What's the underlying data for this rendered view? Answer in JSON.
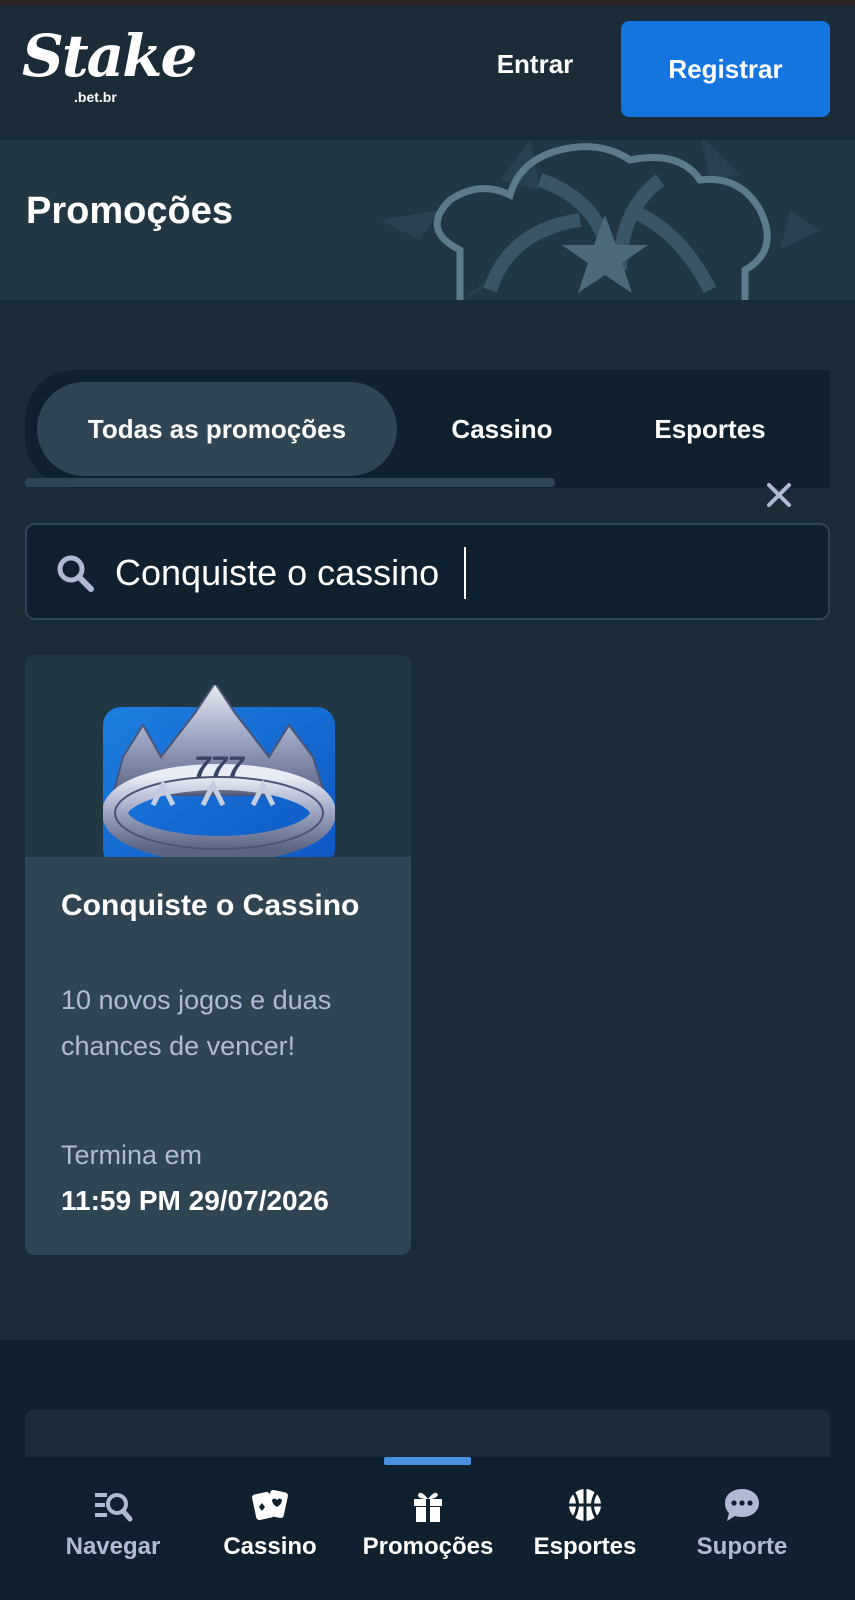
{
  "header": {
    "logo_main": "Stake",
    "logo_sub": ".bet.br",
    "login_label": "Entrar",
    "register_label": "Registrar"
  },
  "banner": {
    "title": "Promoções"
  },
  "tabs": [
    {
      "label": "Todas as promoções",
      "active": true
    },
    {
      "label": "Cassino",
      "active": false
    },
    {
      "label": "Esportes",
      "active": false
    }
  ],
  "search": {
    "value": "Conquiste o cassino"
  },
  "promotions": [
    {
      "title": "Conquiste o Cassino",
      "description": "10 novos jogos e duas chances de vencer!",
      "end_label": "Termina em",
      "end_date": "11:59 PM 29/07/2026",
      "thumb_text": "777"
    }
  ],
  "bottom_nav": [
    {
      "label": "Navegar",
      "icon": "browse-icon",
      "active": false
    },
    {
      "label": "Cassino",
      "icon": "cards-icon",
      "active": false
    },
    {
      "label": "Promoções",
      "icon": "gift-icon",
      "active": true
    },
    {
      "label": "Esportes",
      "icon": "basketball-icon",
      "active": false
    },
    {
      "label": "Suporte",
      "icon": "chat-icon",
      "active": false
    }
  ],
  "colors": {
    "background": "#1a2c38",
    "panel": "#0f212e",
    "accent": "#1475e1",
    "muted_text": "#b1bad3"
  }
}
